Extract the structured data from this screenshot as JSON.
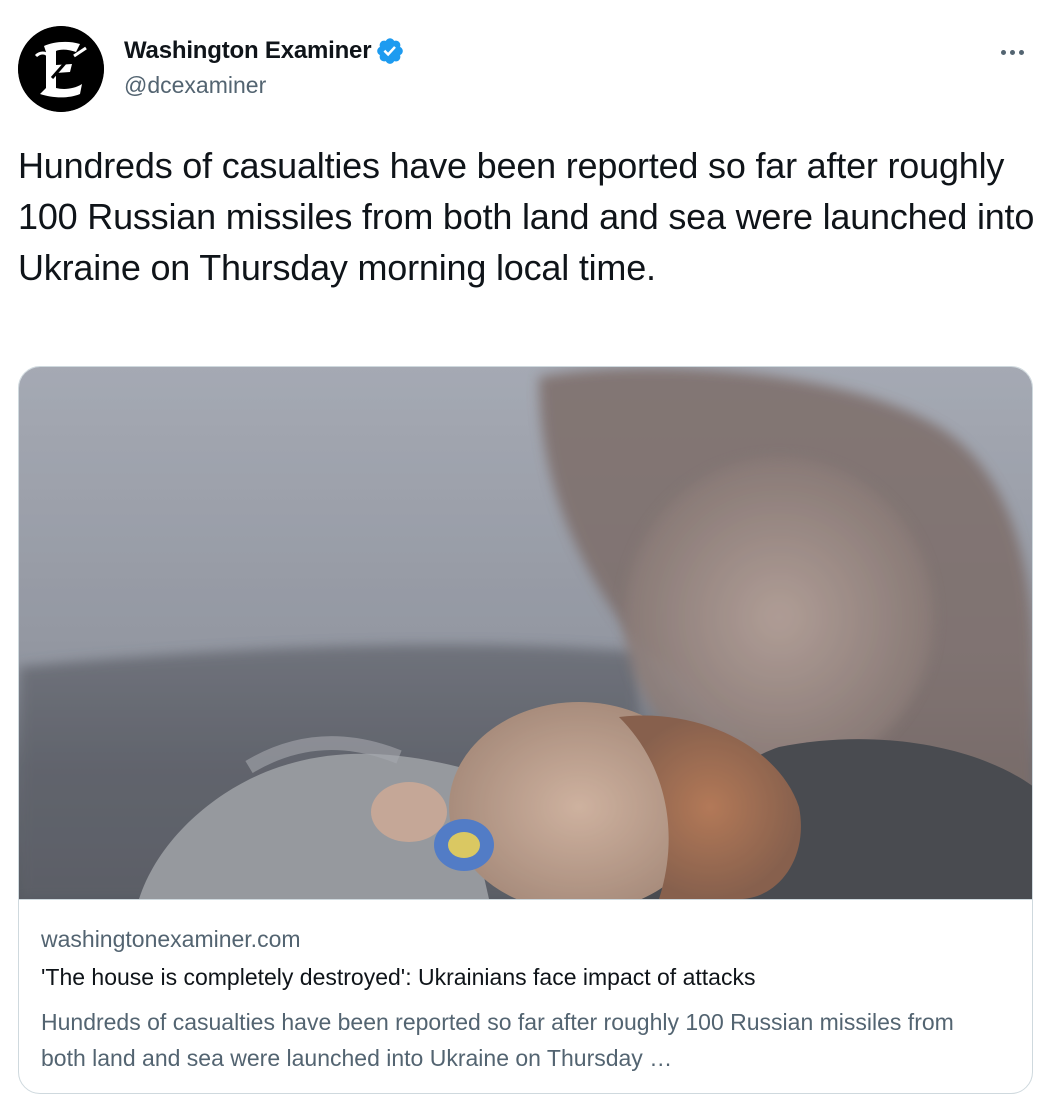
{
  "account": {
    "display_name": "Washington Examiner",
    "handle": "@dcexaminer",
    "verified": true,
    "avatar_icon": "gothic-e-logo-icon"
  },
  "tweet": {
    "text": "Hundreds of casualties have been reported so far after roughly 100 Russian missiles from both land and sea were launched into Ukraine on Thursday morning local time."
  },
  "card": {
    "domain": "washingtonexaminer.com",
    "title": "'The house is completely destroyed': Ukrainians face impact of attacks",
    "description": "Hundreds of casualties have been reported so far after roughly 100 Russian missiles from both land and sea were launched into Ukraine on Thursday …"
  },
  "colors": {
    "text_primary": "#0f1419",
    "text_secondary": "#536471",
    "verified_blue": "#1d9bf0",
    "border": "#cfd9de"
  },
  "icons": {
    "verified": "verified-badge-icon",
    "more": "more-options-icon"
  }
}
